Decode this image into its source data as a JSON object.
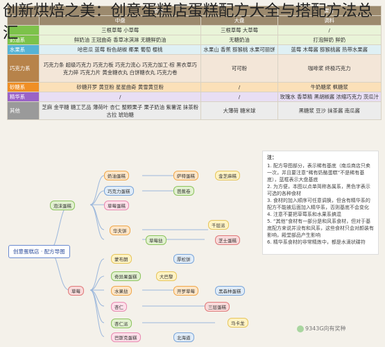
{
  "title": "创新烘焙之美：创意蛋糕店蛋糕配方大全与搭配方法总汇",
  "table": {
    "headers": [
      "",
      "",
      "原味",
      "",
      "",
      "果汁"
    ],
    "subheaders": [
      "",
      "中盘",
      "",
      "大盘",
      "",
      "调料"
    ],
    "rows": [
      {
        "cat": "",
        "cells": [
          "三根草莓 小草莓",
          "",
          "三根草莓 大草莓",
          "",
          "/"
        ]
      },
      {
        "cat": "奶油系",
        "cells": [
          "鲜奶油 王冠曲奇 香草冰淇淋 无糖鲜奶油",
          "",
          "无糖奶油",
          "",
          "打泡鲜奶 鲜奶"
        ]
      },
      {
        "cat": "水果系",
        "cells": [
          "哈密瓜 蓝莓 粉色胡椒 椰果 葡萄 樱桃",
          "",
          "水果山 香蕉 猕猴桃 水果可丽饼",
          "",
          "蓝莓 木莓酱 猕猴桃酱 热带水果酱"
        ]
      },
      {
        "cat": "巧克力系",
        "cells": [
          "巧克力条 超级巧克力 巧克力板 巧克力流心 巧克力加工·棕 黑衣草巧克力碎 巧克力片 黄金糖衣丸 白饼糖衣丸 巧克力卷",
          "",
          "可可粉",
          "",
          "咖啡浆 终极巧克力"
        ]
      },
      {
        "cat": "砂糖系",
        "cells": [
          "砂糖开罗 黄豆粉 星星曲奇 黄雪黄豆粉",
          "",
          "/",
          "",
          "牛奶糖浆 枫糖浆"
        ]
      },
      {
        "cat": "精华系",
        "cells": [
          "/",
          "",
          "/",
          "",
          "玫瑰水 香草精 黑胡椒酱 浓缩巧克力 茨瓜汁"
        ]
      },
      {
        "cat": "其他",
        "cells": [
          "芝麻 金平糖 糖工艺品 薄荷叶 杏仁 整颗栗子 栗子奶油 紫薯泥 抹茶粉 古拉 琥珀糖",
          "",
          "大薄荷 糖米球",
          "",
          "黑糖浆 豆沙 抹茶酱 南瓜酱"
        ]
      }
    ]
  },
  "notes": {
    "heading": "注：",
    "lines": [
      "1. 配方导图部分，表示稀有基底（南瓜商店只卖一次，并且要注意“稀有奶酪蛋糕”不是稀有基底），蓝框表示大盘基底",
      "2. 为方便，本图以点单简称各属系，黑色字表示可选的各种食材",
      "3. 食材的加入顺序可任意调换，但含有精华系的配方不能被后面加入精华系，否则基底不会变化",
      "4. 注意不要把草莓系和水果系搞混",
      "5. “其他”食材有一部分是和风系食材，但对于基底配方来说并没有和风系，这些食材只会对颜装有影响，殿堂部品产生影响",
      "6. 精华系食材的非常精炼中，都是水滴状碟符"
    ]
  },
  "mindmap": {
    "root": "创意蛋糕店 · 配方导图",
    "level1": [
      "泡沫蛋糕",
      "草莓"
    ],
    "nodes": [
      "奶油蛋糕",
      "巧克力蛋糕",
      "萨特蛋糕",
      "金芝麻糕",
      "芭蕉卷",
      "草莓蛋糕",
      "华夫饼",
      "千层派",
      "草莓挞",
      "芝士蛋糕",
      "厚松饼",
      "蒙布朗",
      "奇异果蛋糕",
      "大巴黎",
      "水果挞",
      "杏仁",
      "开罗草莓",
      "黑森林蛋糕",
      "三层蛋糕",
      "马卡龙",
      "杏仁派",
      "巴斯克蛋糕",
      "北海道"
    ]
  },
  "watermark": "9343G向有奖种"
}
